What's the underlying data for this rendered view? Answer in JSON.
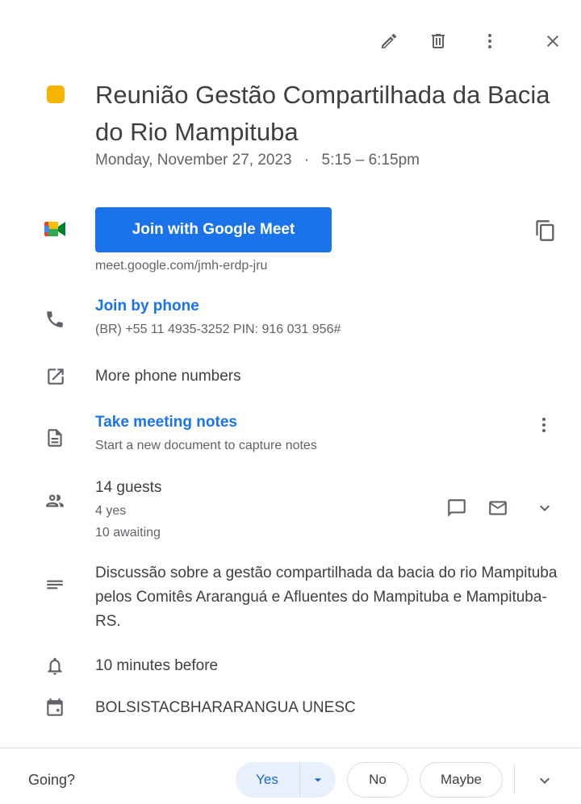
{
  "toolbar": {
    "edit_icon": "pencil-icon",
    "delete_icon": "trash-icon",
    "more_icon": "more-vert-icon",
    "close_icon": "close-icon"
  },
  "event": {
    "color": "#F4B400",
    "title": "Reunião Gestão Compartilhada da Bacia do Rio Mampituba",
    "date": "Monday, November 27, 2023",
    "separator": "·",
    "time": "5:15 – 6:15pm"
  },
  "meet": {
    "button_label": "Join with Google Meet",
    "url": "meet.google.com/jmh-erdp-jru",
    "colors": [
      "#34A853",
      "#FBBC04",
      "#EA4335",
      "#4285F4"
    ]
  },
  "phone": {
    "label": "Join by phone",
    "detail": "(BR) +55 11 4935-3252 PIN: 916 031 956#"
  },
  "more_phones": {
    "label": "More phone numbers"
  },
  "notes": {
    "label": "Take meeting notes",
    "detail": "Start a new document to capture notes"
  },
  "guests": {
    "count": "14 guests",
    "yes": "4 yes",
    "awaiting": "10 awaiting"
  },
  "description": "Discussão sobre a gestão compartilhada da bacia do rio Mampituba pelos Comitês Araranguá e Afluentes do Mampituba e Mampituba-RS.",
  "reminder": "10 minutes before",
  "calendar_owner": "BOLSISTACBHARARANGUA UNESC",
  "rsvp": {
    "question": "Going?",
    "yes": "Yes",
    "no": "No",
    "maybe": "Maybe",
    "accent": "#1a73e8"
  }
}
